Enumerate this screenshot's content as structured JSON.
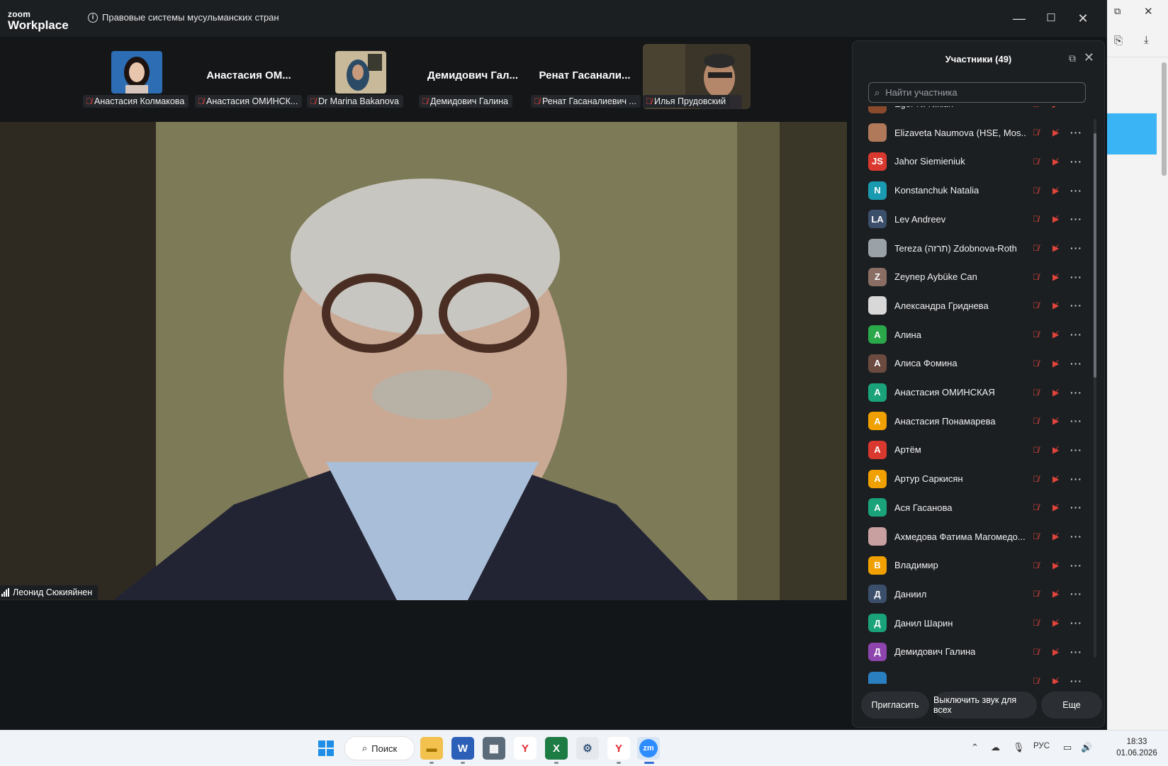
{
  "window": {
    "app_logo_line1": "zoom",
    "app_logo_line2": "Workplace",
    "meeting_title": "Правовые системы мусульманских стран",
    "minimize": "—",
    "maximize": "☐",
    "close": "✕"
  },
  "strip": [
    {
      "caption": "Анастасия Колмакова",
      "big": ""
    },
    {
      "caption": "Анастасия ОМИНСК...",
      "big": "Анастасия  ОМ..."
    },
    {
      "caption": "Dr Marina Bakanova",
      "big": ""
    },
    {
      "caption": "Демидович Галина",
      "big": "Демидович  Гал..."
    },
    {
      "caption": "Ренат Гасаналиевич ...",
      "big": "Ренат  Гасанали..."
    },
    {
      "caption": "Илья Прудовский",
      "big": ""
    }
  ],
  "main_video": {
    "speaker_name": "Леонид Сюкияйнен"
  },
  "panel": {
    "title": "Участники (49)",
    "search_placeholder": "Найти участника",
    "participants": [
      {
        "initials": "",
        "name": "Egor N. Nikitin",
        "color": "#8a4b2d"
      },
      {
        "initials": "",
        "name": "Elizaveta Naumova (HSE, Mos...",
        "color": "#b07a5a"
      },
      {
        "initials": "JS",
        "name": "Jahor Siemieniuk",
        "color": "#d9382f"
      },
      {
        "initials": "N",
        "name": "Konstanchuk Natalia",
        "color": "#1a9ab0"
      },
      {
        "initials": "LA",
        "name": "Lev Andreev",
        "color": "#3b4f6b"
      },
      {
        "initials": "",
        "name": "Tereza (תרזה) Zdobnova-Roth",
        "color": "#9aa2a8"
      },
      {
        "initials": "Z",
        "name": "Zeynep Aybüke Can",
        "color": "#8a6e64"
      },
      {
        "initials": "",
        "name": "Александра Гриднева",
        "color": "#d8d8d8"
      },
      {
        "initials": "А",
        "name": "Алина",
        "color": "#2aa84a"
      },
      {
        "initials": "А",
        "name": "Алиса Фомина",
        "color": "#6b4a40"
      },
      {
        "initials": "А",
        "name": "Анастасия ОМИНСКАЯ",
        "color": "#1aa37a"
      },
      {
        "initials": "А",
        "name": "Анастасия Понамарева",
        "color": "#f0a000"
      },
      {
        "initials": "А",
        "name": "Артём",
        "color": "#d9382f"
      },
      {
        "initials": "А",
        "name": "Артур Саркисян",
        "color": "#f0a000"
      },
      {
        "initials": "А",
        "name": "Ася Гасанова",
        "color": "#1aa37a"
      },
      {
        "initials": "",
        "name": "Ахмедова Фатима Магомедо...",
        "color": "#c9a0a0"
      },
      {
        "initials": "В",
        "name": "Владимир",
        "color": "#f0a000"
      },
      {
        "initials": "Д",
        "name": "Даниил",
        "color": "#3b4f6b"
      },
      {
        "initials": "Д",
        "name": "Данил Шарин",
        "color": "#1aa37a"
      },
      {
        "initials": "Д",
        "name": "Демидович Галина",
        "color": "#8e44ad"
      },
      {
        "initials": "",
        "name": "",
        "color": "#2a7fc0"
      }
    ],
    "invite": "Пригласить",
    "mute_all": "Выключить звук для всех",
    "more": "Еще"
  },
  "taskbar": {
    "search": "Поиск",
    "lang": "РУС",
    "time": "18:33",
    "date": "01.06.2026"
  }
}
